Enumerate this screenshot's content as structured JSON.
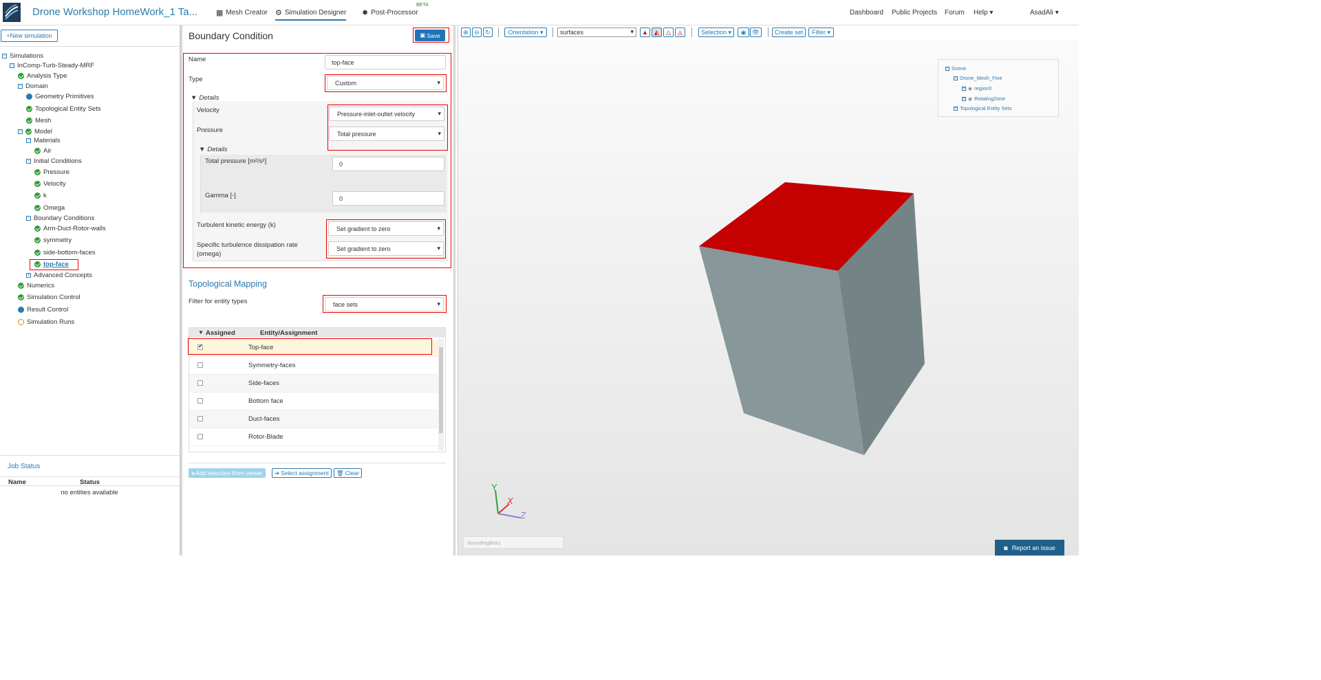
{
  "app": {
    "project_title": "Drone Workshop HomeWork_1 Ta...",
    "nav": [
      "Mesh Creator",
      "Simulation Designer",
      "Post-Processor"
    ],
    "beta_label": "BETA",
    "right_nav": [
      "Dashboard",
      "Public Projects",
      "Forum",
      "Help",
      "AsadAli"
    ]
  },
  "sidebar": {
    "new_simulation": "New simulation",
    "tree": {
      "simulations": "Simulations",
      "sim_name": "InComp-Turb-Steady-MRF",
      "analysis_type": "Analysis Type",
      "domain": "Domain",
      "geometry_primitives": "Geometry Primitives",
      "topological_entity_sets": "Topological Entity Sets",
      "mesh": "Mesh",
      "model": "Model",
      "materials": "Materials",
      "air": "Air",
      "initial_conditions": "Initial Conditions",
      "pressure": "Pressure",
      "velocity": "Velocity",
      "k": "k",
      "omega": "Omega",
      "boundary_conditions": "Boundary Conditions",
      "bc1": "Arm-Duct-Rotor-walls",
      "bc2": "symmetry",
      "bc3": "side-bottom-faces",
      "bc4": "top-face",
      "advanced_concepts": "Advanced Concepts",
      "numerics": "Numerics",
      "simulation_control": "Simulation Control",
      "result_control": "Result Control",
      "simulation_runs": "Simulation Runs"
    },
    "job_status": {
      "title": "Job Status",
      "col_name": "Name",
      "col_status": "Status",
      "empty": "no entities available"
    }
  },
  "form": {
    "title": "Boundary Condition",
    "save": "Save",
    "name_label": "Name",
    "name_value": "top-face",
    "type_label": "Type",
    "type_value": "Custom",
    "details": "Details",
    "velocity_label": "Velocity",
    "velocity_value": "Pressure-inlet-outlet velocity",
    "pressure_label": "Pressure",
    "pressure_value": "Total pressure",
    "details2": "Details",
    "total_pressure_label": "Total pressure [m²/s²]",
    "total_pressure_value": "0",
    "gamma_label": "Gamma [-]",
    "gamma_value": "0",
    "tke_label": "Turbulent kinetic energy (k)",
    "tke_value": "Set gradient to zero",
    "sdr_label_1": "Specific turbulence dissipation rate",
    "sdr_label_2": "(omega)",
    "sdr_value": "Set gradient to zero"
  },
  "topo": {
    "title": "Topological Mapping",
    "filter_label": "Filter for entity types",
    "filter_value": "face sets",
    "col_assigned": "Assigned",
    "col_entity": "Entity/Assignment",
    "rows": [
      {
        "name": "Top-face",
        "checked": true
      },
      {
        "name": "Symmetry-faces",
        "checked": false
      },
      {
        "name": "Side-faces",
        "checked": false
      },
      {
        "name": "Bottom face",
        "checked": false
      },
      {
        "name": "Duct-faces",
        "checked": false
      },
      {
        "name": "Rotor-Blade",
        "checked": false
      }
    ],
    "add_selection": "Add selection from viewer",
    "select_assignment": "Select assignment",
    "clear": "Clear"
  },
  "viewer": {
    "orientation": "Orientation",
    "surfaces": "surfaces",
    "selection": "Selection",
    "create_set": "Create set",
    "filter": "Filter",
    "scene": {
      "root": "Scene",
      "mesh": "Drone_Mesh_Fine",
      "region0": "region0",
      "rotating": "RotatingZone",
      "tes": "Topological Entity Sets"
    },
    "bounding_box": "boundingBox1",
    "report": "Report an issue",
    "axis_x": "X",
    "axis_y": "Y",
    "axis_z": "Z"
  },
  "colors": {
    "accent": "#2a7ab0",
    "selected_face": "#c40000",
    "cube": "#87979a",
    "highlight_border": "#e00000"
  }
}
